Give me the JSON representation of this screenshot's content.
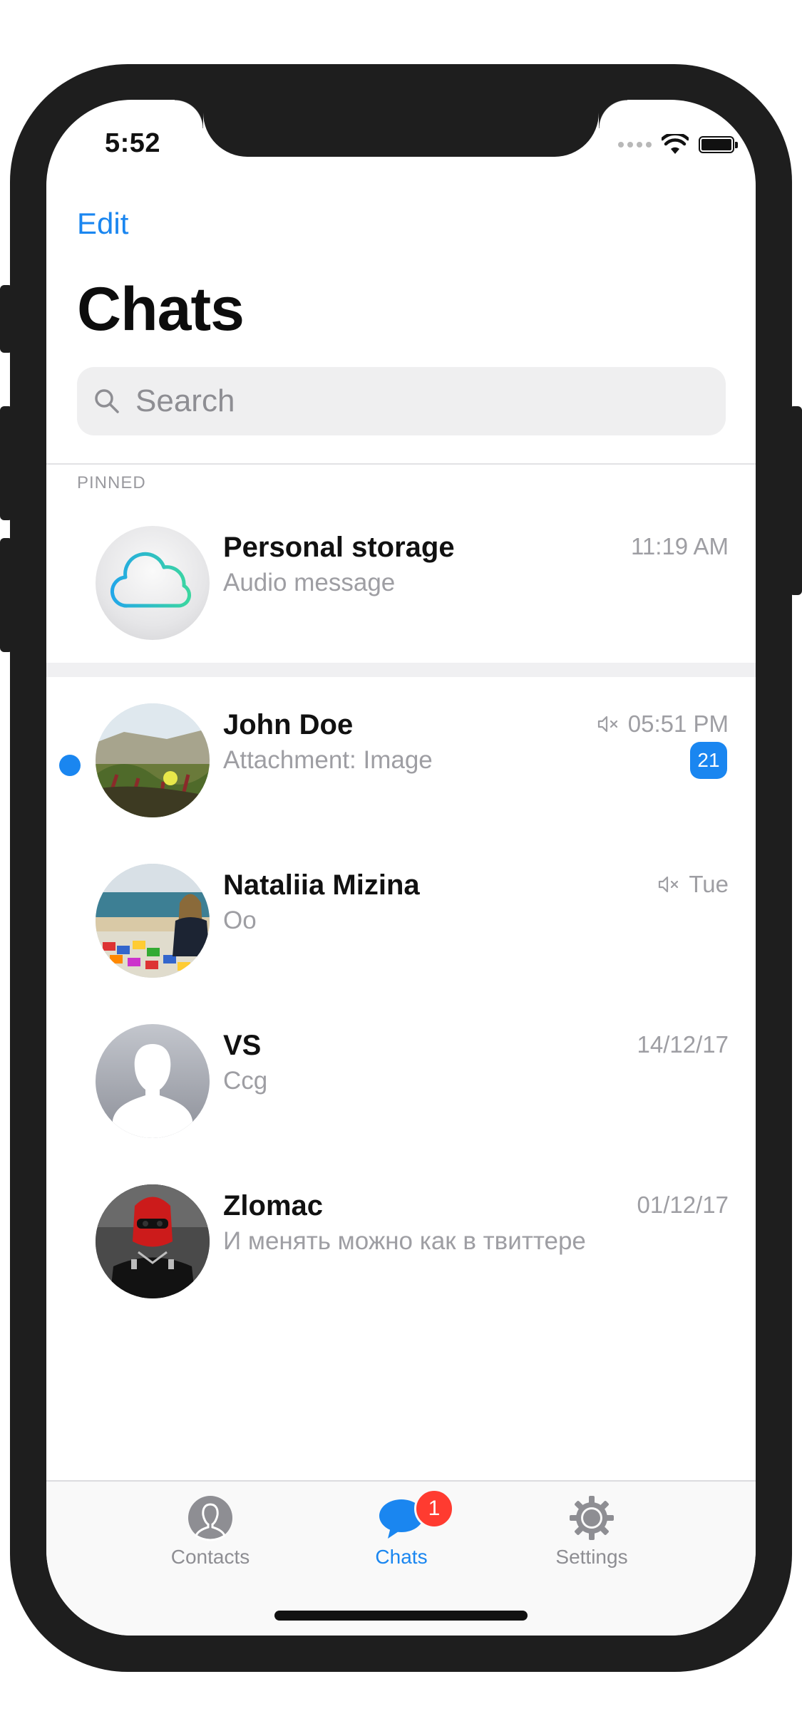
{
  "status_bar": {
    "time": "5:52"
  },
  "header": {
    "edit_label": "Edit",
    "title": "Chats"
  },
  "search": {
    "placeholder": "Search"
  },
  "pinned_section": {
    "label": "PINNED"
  },
  "chats": [
    {
      "name": "Personal storage",
      "message": "Audio message",
      "time": "11:19 AM",
      "muted": false,
      "pinned": true,
      "avatar_icon": "cloud-icon"
    },
    {
      "name": "John Doe",
      "message": "Attachment: Image",
      "time": "05:51 PM",
      "muted": true,
      "unread": true,
      "unread_count": "21"
    },
    {
      "name": "Nataliia Mizina",
      "message": "Oo",
      "time": "Tue",
      "muted": true
    },
    {
      "name": "VS",
      "message": "Ccg",
      "time": "14/12/17",
      "muted": false,
      "avatar_icon": "person-silhouette-icon"
    },
    {
      "name": "Zlomac",
      "message": "И менять можно как в твиттере",
      "time": "01/12/17",
      "muted": false
    }
  ],
  "tabbar": {
    "tabs": [
      {
        "label": "Contacts",
        "icon": "contacts-icon",
        "active": false
      },
      {
        "label": "Chats",
        "icon": "chat-bubble-icon",
        "active": true,
        "badge": "1"
      },
      {
        "label": "Settings",
        "icon": "gear-icon",
        "active": false
      }
    ]
  },
  "colors": {
    "accent": "#1a86f0",
    "badge_red": "#ff3b30",
    "secondary_text": "#9e9ea3"
  }
}
